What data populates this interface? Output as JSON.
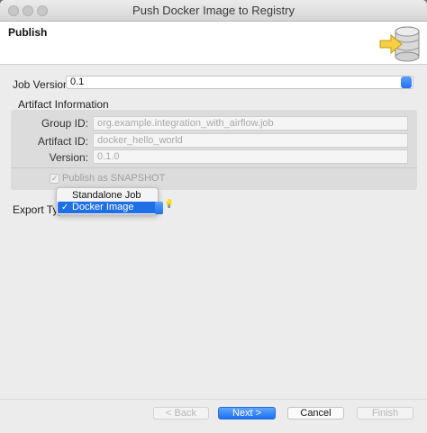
{
  "window": {
    "title": "Push Docker Image to Registry"
  },
  "header": {
    "title": "Publish",
    "icon": "database-export-icon"
  },
  "job_version": {
    "label": "Job Version",
    "value": "0.1"
  },
  "artifact": {
    "section_label": "Artifact Information",
    "group_id": {
      "label": "Group ID:",
      "value": "org.example.integration_with_airflow.job"
    },
    "artifact_id": {
      "label": "Artifact ID:",
      "value": "docker_hello_world"
    },
    "version": {
      "label": "Version:",
      "value": "0.1.0"
    },
    "snapshot": {
      "label": "Publish as SNAPSHOT",
      "checked": true
    }
  },
  "export_type": {
    "label": "Export Type",
    "options": [
      "Standalone Job",
      "Docker Image"
    ],
    "selected": "Docker Image",
    "checkmark": "✓"
  },
  "buttons": {
    "back": "< Back",
    "next": "Next >",
    "cancel": "Cancel",
    "finish": "Finish"
  }
}
